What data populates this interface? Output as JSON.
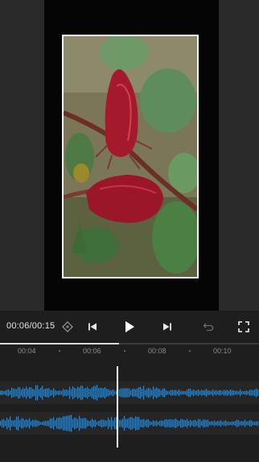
{
  "player": {
    "current_time": "00:06",
    "total_time": "00:15",
    "progress": 0.46
  },
  "controls": {
    "keyframe_icon": "diamond-keyframe-icon",
    "prev_icon": "skip-previous-icon",
    "play_icon": "play-icon",
    "next_icon": "skip-next-icon",
    "undo_icon": "undo-icon",
    "fullscreen_icon": "fullscreen-icon"
  },
  "timeline": {
    "ticks": [
      "00:04",
      "00:06",
      "00:08",
      "00:10"
    ]
  },
  "audio_tracks": [
    {
      "name": "",
      "color": "#1e8fe6"
    },
    {
      "name": "",
      "color": "#1e8fe6"
    }
  ],
  "colors": {
    "accent": "#1e8fe6",
    "background": "#1e1e1e"
  }
}
